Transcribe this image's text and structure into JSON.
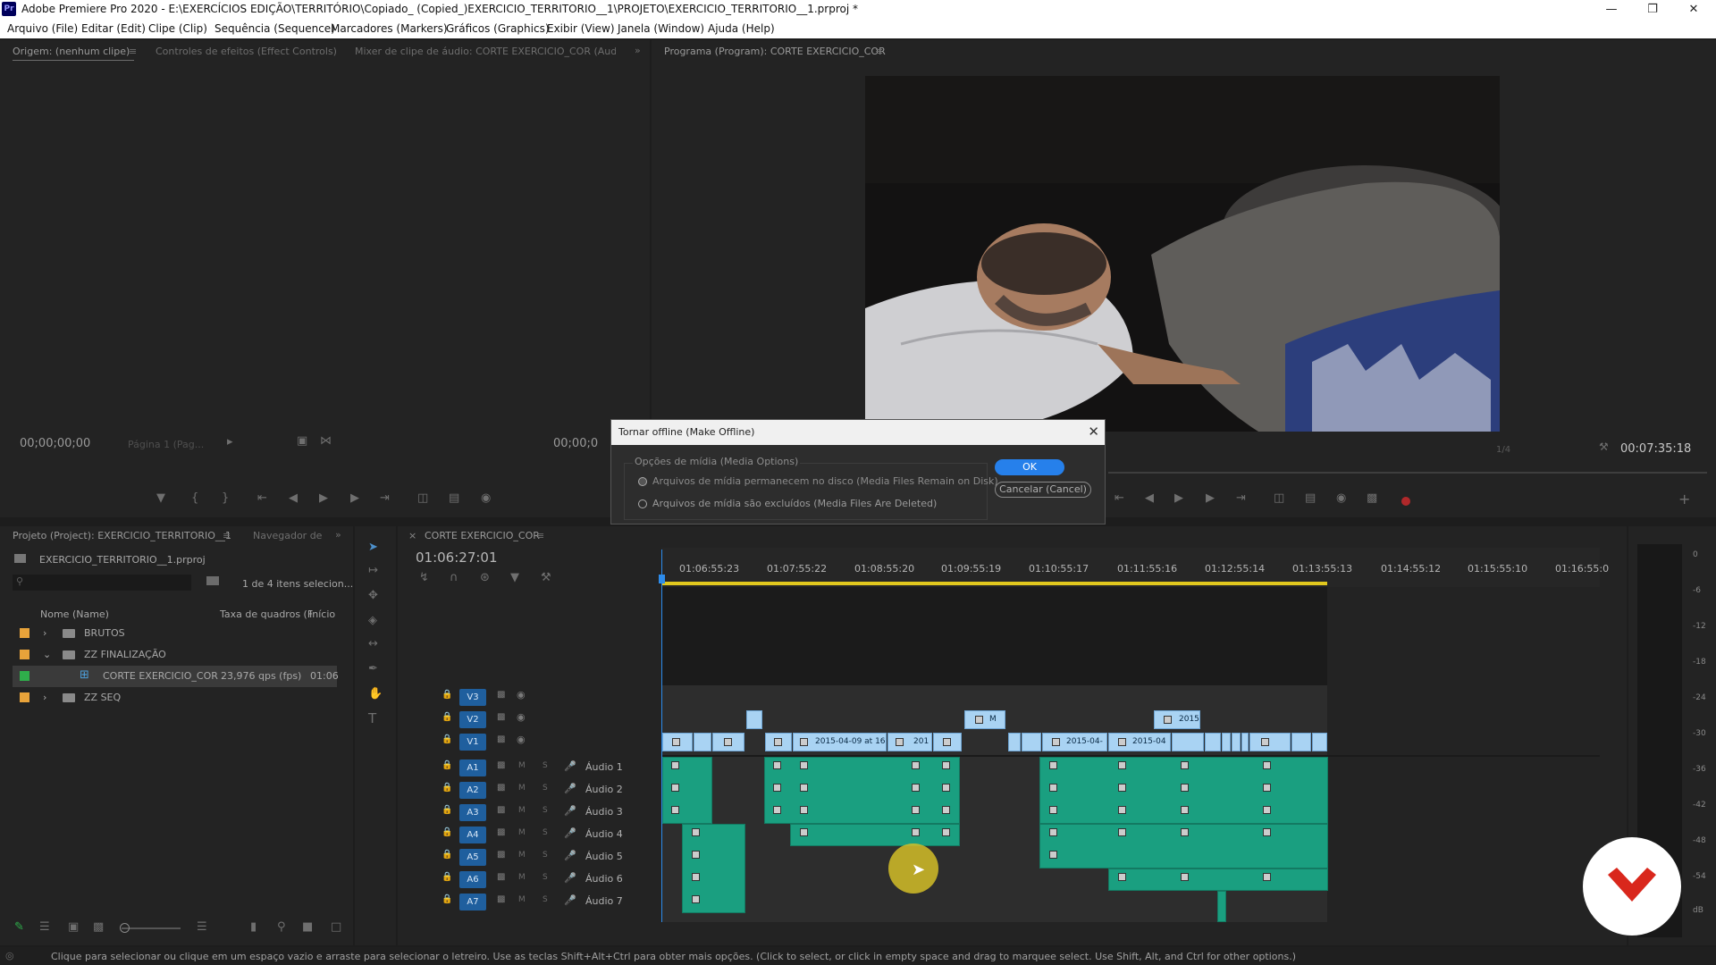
{
  "window": {
    "title": "Adobe Premiere Pro 2020 - E:\\EXERCÍCIOS EDIÇÃO\\TERRITÓRIO\\Copiado_ (Copied_)EXERCICIO_TERRITORIO__1\\PROJETO\\EXERCICIO_TERRITORIO__1.prproj *",
    "app_icon": "Pr"
  },
  "menu": [
    "Arquivo (File)",
    "Editar (Edit)",
    "Clipe (Clip)",
    "Sequência (Sequence)",
    "Marcadores (Markers)",
    "Gráficos (Graphics)",
    "Exibir (View)",
    "Janela (Window)",
    "Ajuda (Help)"
  ],
  "source_panel": {
    "tabs": [
      "Origem: (nenhum clipe)",
      "Controles de efeitos (Effect Controls)",
      "Mixer de clipe de áudio: CORTE EXERCICIO_COR (Audio Cl"
    ],
    "timecode_left": "00;00;00;00",
    "page_dropdown": "Página 1 (Pag...",
    "timecode_right": "00;00;0"
  },
  "program_panel": {
    "tab": "Programa (Program): CORTE EXERCICIO_COR",
    "zoom_dropdown": "1/4",
    "timecode_right": "00:07:35:18"
  },
  "project_panel": {
    "tabs": [
      "Projeto (Project): EXERCICIO_TERRITORIO__1",
      "Navegador de"
    ],
    "filename": "EXERCICIO_TERRITORIO__1.prproj",
    "selection_count": "1 de 4 itens selecion...",
    "columns": [
      "Nome (Name)",
      "Taxa de quadros (F",
      "Início"
    ],
    "rows": [
      {
        "name": "BRUTOS",
        "color": "#e8a33a",
        "expand": "›",
        "type": "folder",
        "rate": "",
        "start": ""
      },
      {
        "name": "ZZ FINALIZAÇÃO",
        "color": "#e8a33a",
        "expand": "⌄",
        "type": "folder",
        "rate": "",
        "start": ""
      },
      {
        "name": "CORTE EXERCICIO_COR",
        "color": "#2fae4b",
        "expand": "",
        "type": "sequence",
        "rate": "23,976 qps (fps)",
        "start": "01:06"
      },
      {
        "name": "ZZ SEQ",
        "color": "#e8a33a",
        "expand": "›",
        "type": "folder",
        "rate": "",
        "start": ""
      }
    ]
  },
  "timeline": {
    "tab": "CORTE EXERCICIO_COR",
    "timecode": "01:06:27:01",
    "ruler_labels": [
      "01:06:55:23",
      "01:07:55:22",
      "01:08:55:20",
      "01:09:55:19",
      "01:10:55:17",
      "01:11:55:16",
      "01:12:55:14",
      "01:13:55:13",
      "01:14:55:12",
      "01:15:55:10",
      "01:16:55:0"
    ],
    "video_tracks": [
      {
        "id": "V3"
      },
      {
        "id": "V2"
      },
      {
        "id": "V1"
      }
    ],
    "audio_tracks": [
      {
        "id": "A1",
        "name": "Áudio 1"
      },
      {
        "id": "A2",
        "name": "Áudio 2"
      },
      {
        "id": "A3",
        "name": "Áudio 3"
      },
      {
        "id": "A4",
        "name": "Áudio 4"
      },
      {
        "id": "A5",
        "name": "Áudio 5"
      },
      {
        "id": "A6",
        "name": "Áudio 6"
      },
      {
        "id": "A7",
        "name": "Áudio 7"
      }
    ],
    "clip_labels": {
      "v2_a": "M",
      "v2_b": "2015",
      "v1_a": "2015-04-09 at 16",
      "v1_b": "201",
      "v1_c": "2015-04-",
      "v1_d": "2015-04"
    },
    "track_letters": {
      "mute": "M",
      "solo": "S"
    }
  },
  "meter": {
    "labels": [
      "0",
      "-6",
      "-12",
      "-18",
      "-24",
      "-30",
      "-36",
      "-42",
      "-48",
      "-54",
      "dB"
    ]
  },
  "dialog": {
    "title": "Tornar offline (Make Offline)",
    "group_label": "Opções de mídia (Media Options)",
    "option1": "Arquivos de mídia permanecem no disco (Media Files Remain on Disk)",
    "option2": "Arquivos de mídia são excluídos (Media Files Are Deleted)",
    "ok": "OK",
    "cancel": "Cancelar (Cancel)",
    "close": "✕"
  },
  "status_bar": "Clique para selecionar ou clique em um espaço vazio e arraste para selecionar o letreiro. Use as teclas Shift+Alt+Ctrl para obter mais opções. (Click to select, or click in empty space and drag to marquee select. Use Shift, Alt, and Ctrl for other options.)",
  "colors": {
    "accent": "#2680eb",
    "video_clip": "#a9d3f3",
    "audio_clip": "#1a9f80",
    "playhead": "#2d8ceb",
    "logo": "#d9271c"
  }
}
